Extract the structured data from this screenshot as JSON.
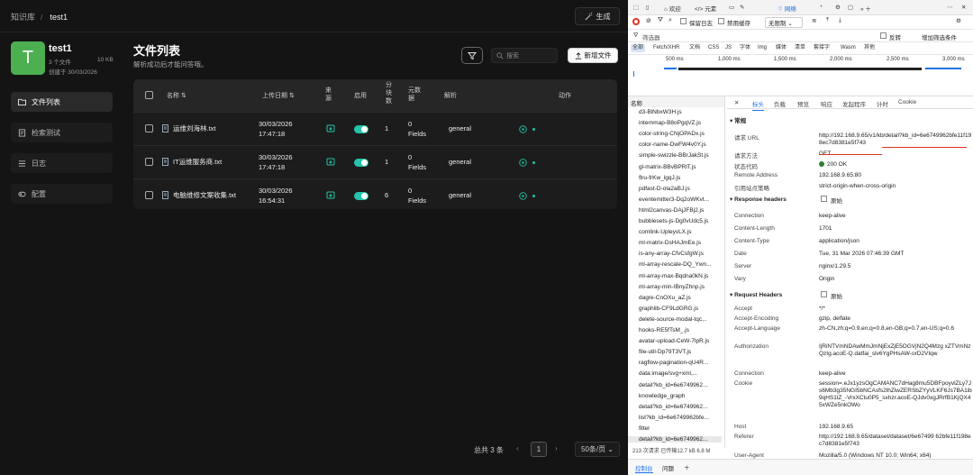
{
  "app": {
    "breadcrumb": {
      "root": "知识库",
      "current": "test1"
    },
    "generate_label": "生成",
    "kb": {
      "avatar_letter": "T",
      "name": "test1",
      "files": "3 个文件",
      "size": "10 KB",
      "created": "创建于 30/03/2026"
    },
    "nav": [
      {
        "label": "文件列表"
      },
      {
        "label": "检索测试"
      },
      {
        "label": "日志"
      },
      {
        "label": "配置"
      }
    ],
    "title": "文件列表",
    "subtitle": "解析成功后才能问答哦。",
    "search_placeholder": "搜索",
    "add_file_label": "新增文件",
    "columns": {
      "name": "名称",
      "upload": "上传日期",
      "source1": "来",
      "source2": "源",
      "enable": "启用",
      "chunks1": "分",
      "chunks2": "块",
      "chunks3": "数",
      "meta1": "元数",
      "meta2": "据",
      "parse": "解析",
      "action": "动作"
    },
    "rows": [
      {
        "name": "运维刘海林.txt",
        "date": "30/03/2026",
        "time": "17:47:18",
        "chunks": "1",
        "meta1": "0",
        "meta2": "Fields",
        "parser": "general"
      },
      {
        "name": "IT运维服务商.txt",
        "date": "30/03/2026",
        "time": "17:47:18",
        "chunks": "1",
        "meta1": "0",
        "meta2": "Fields",
        "parser": "general"
      },
      {
        "name": "电脑维修文案收集.txt",
        "date": "30/03/2026",
        "time": "16:54:31",
        "chunks": "6",
        "meta1": "0",
        "meta2": "Fields",
        "parser": "general"
      }
    ],
    "pager": {
      "total": "总共 3 条",
      "page": "1",
      "per_page": "50条/页"
    },
    "accent": "#25c3a8"
  },
  "devtools": {
    "tabs": [
      "欢迎",
      "元素",
      "网络",
      "性能"
    ],
    "options": {
      "preserve": "保留日志",
      "disable_cache": "禁用缓存",
      "throttle": "无限制"
    },
    "filter": {
      "label": "筛选器",
      "invert": "反转",
      "more": "增加筛选条件"
    },
    "types": [
      "全部",
      "Fetch/XHR",
      "文档",
      "CSS",
      "JS",
      "字体",
      "Img",
      "媒体",
      "清单",
      "套接字",
      "Wasm",
      "其他"
    ],
    "timeline_ticks": [
      "500 ms",
      "1,000 ms",
      "1,500 ms",
      "2,000 ms",
      "2,500 ms",
      "3,000 ms"
    ],
    "list_header": "名称",
    "requests": [
      "d3-BlNbxW3H.js",
      "internmap-B8oPgqVZ.js",
      "color-string-CNjOPADx.js",
      "color-name-DwFW4v0Y.js",
      "simple-swizzle-BBrJakSt.js",
      "gl-matrix-BBvBPRlT.js",
      "flru-frKw_lgqJ.js",
      "pdfast-D-ola2aBJ.js",
      "eventemitter3-Dq2oWKvt...",
      "html2canvas-DAjJFBj2.js",
      "bubblesets-js-Dg0vUdc5.js",
      "comlink-UpleyvLX.js",
      "ml-matrix-DsHAJmEe.js",
      "is-any-array-CfvCsfgW.js",
      "ml-array-rescale-DQ_Ywn...",
      "ml-array-max-Bqdna0kN.js",
      "ml-array-min-IBnyZhnp.js",
      "dagre-CnOXu_aZ.js",
      "graphlib-CF9LdGRG.js",
      "delete-source-modal-tqc...",
      "hooks-RE5fTsM_.js",
      "avatar-upload-CeW-7lpR.js",
      "file-util-Dp79T3VT.js",
      "ragflow-pagination-qU4R...",
      "data:image/svg+xml,...",
      "detail?kb_id=6e6749962...",
      "knowledge_graph",
      "detail?kb_id=6e6749962...",
      "list?kb_id=6e6749962bfe...",
      "filter",
      "detail?kb_id=6e6749962..."
    ],
    "status_text": "213 次请求  已传输12.7 kB  6.8 M",
    "panel_tabs": [
      "标头",
      "负载",
      "预览",
      "响应",
      "发起程序",
      "计时",
      "Cookie"
    ],
    "general_title": "常规",
    "general": [
      {
        "k": "请求 URL",
        "v": "http://192.168.9.65/v1/kb/detail?kb_id=6e6749962bfe11f198ec7d8381e5f743"
      },
      {
        "k": "请求方法",
        "v": "GET"
      },
      {
        "k": "状态代码",
        "v": "200 OK"
      },
      {
        "k": "Remote Address",
        "v": "192.168.9.65:80"
      },
      {
        "k": "引用站点策略",
        "v": "strict-origin-when-cross-origin"
      }
    ],
    "response_title": "Response headers",
    "raw_label": "原始",
    "response": [
      {
        "k": "Connection",
        "v": "keep-alive"
      },
      {
        "k": "Content-Length",
        "v": "1701"
      },
      {
        "k": "Content-Type",
        "v": "application/json"
      },
      {
        "k": "Date",
        "v": "Tue, 31 Mar 2026 07:46:39 GMT"
      },
      {
        "k": "Server",
        "v": "nginx/1.29.5"
      },
      {
        "k": "Vary",
        "v": "Origin"
      }
    ],
    "request_title": "Request Headers",
    "request": [
      {
        "k": "Accept",
        "v": "*/*"
      },
      {
        "k": "Accept-Encoding",
        "v": "gzip, deflate"
      },
      {
        "k": "Accept-Language",
        "v": "zh-CN,zh;q=0.9,en;q=0.8,en-GB;q=0.7,en-US;q=0.6"
      },
      {
        "k": "Authorization",
        "v": "IjRiNTVmNDAwMmJmNjExZjE5OGVjN2Q4Mzg xZTVmNzQzIg.acoE-Q.datfai_slv6YgPHsAW-orD2VIqw"
      },
      {
        "k": "Connection",
        "v": "keep-alive"
      },
      {
        "k": "Cookie",
        "v": "session=.eJx1yzsOgCAMANC7dHag8mu5DBFpoyvlZLy7Js6Mb3g35NGI5bNCAsfs2lhZiwZERSbZYyVLKF6Js7BA1ib9qHS1lZ_-VrxXCtu0P5_sxhzr.acoE-QJdv0xgJRrfB1KjQX45xWZe5nkOWo"
      },
      {
        "k": "Host",
        "v": "192.168.9.65"
      },
      {
        "k": "Referer",
        "v": "http://192.168.9.65/dataset/dataset/6e67499 62bfe11f198ec7d8381e5f743"
      },
      {
        "k": "User-Agent",
        "v": "Mozilla/5.0 (Windows NT 10.0; Win64; x64)"
      }
    ],
    "bottom_tabs": [
      "控制台",
      "问题"
    ]
  }
}
